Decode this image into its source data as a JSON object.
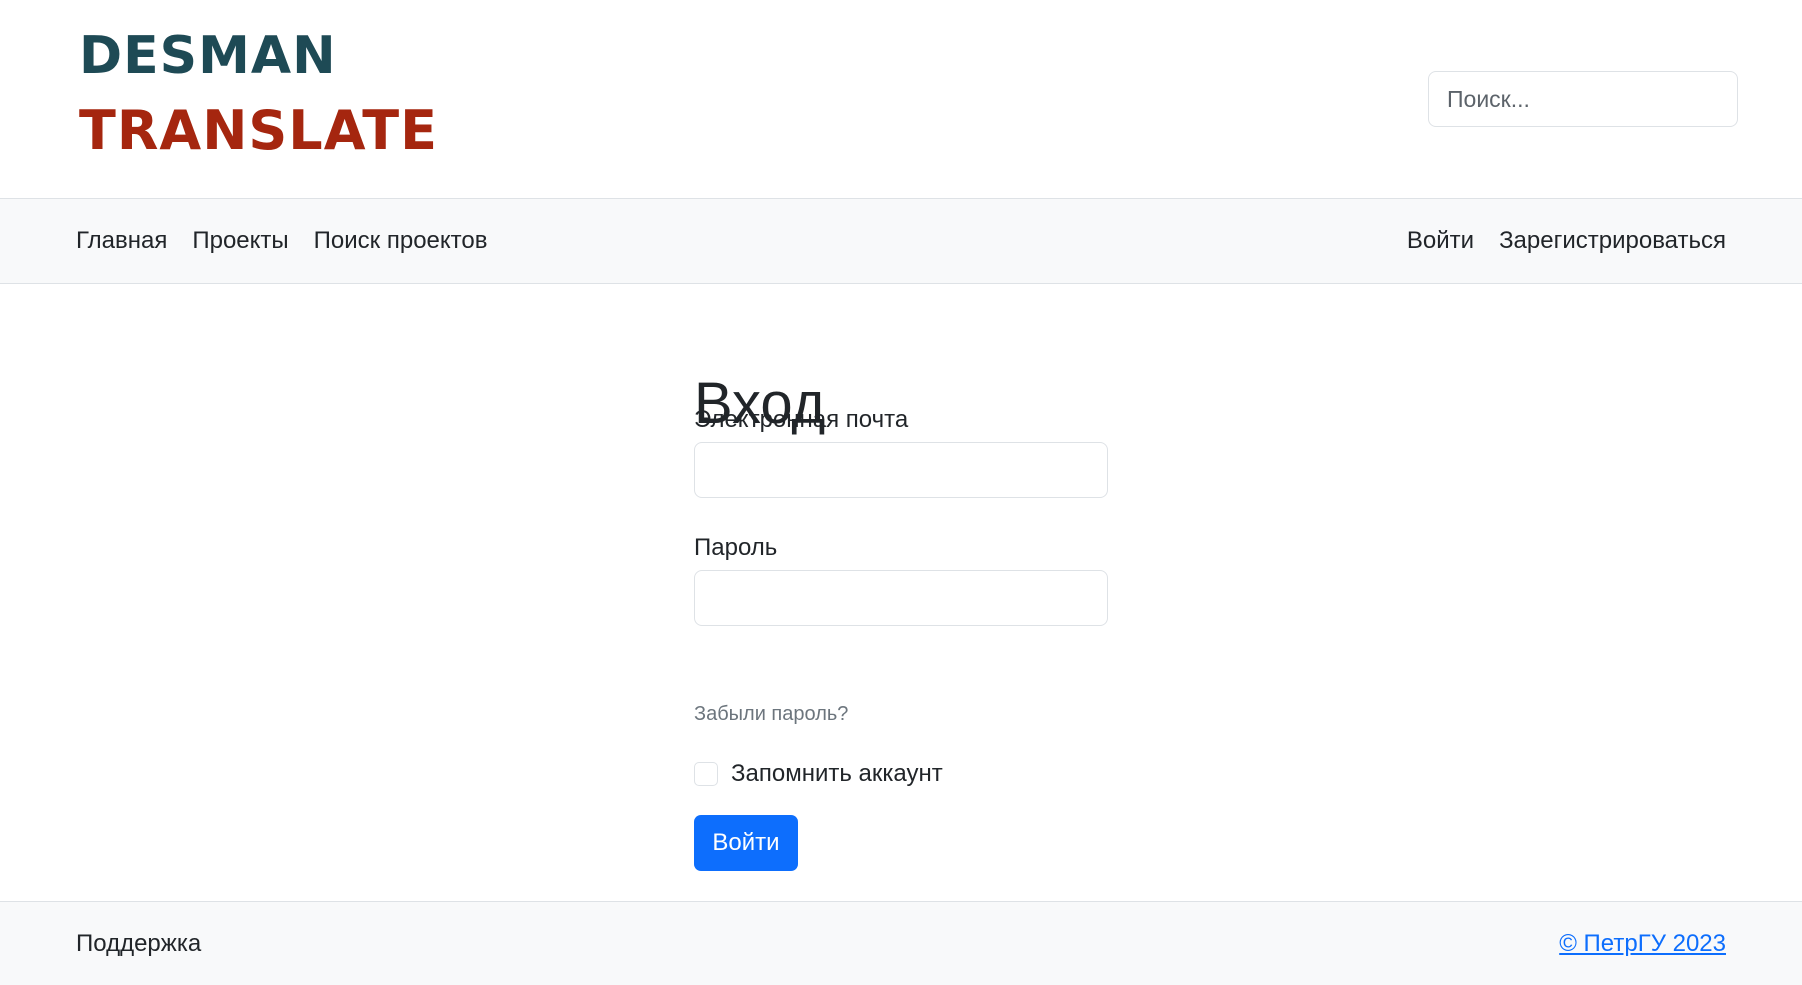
{
  "header": {
    "logo": {
      "line1": "DESMAN",
      "line2": "TRANSLATE",
      "line1_color": "#1e4a55",
      "line2_color": "#a5260f"
    },
    "search": {
      "placeholder": "Поиск...",
      "value": ""
    }
  },
  "nav": {
    "left": [
      {
        "label": "Главная"
      },
      {
        "label": "Проекты"
      },
      {
        "label": "Поиск проектов"
      }
    ],
    "right": [
      {
        "label": "Войти"
      },
      {
        "label": "Зарегистрироваться"
      }
    ]
  },
  "login": {
    "title": "Вход",
    "email": {
      "label": "Электронная почта",
      "value": ""
    },
    "password": {
      "label": "Пароль",
      "value": ""
    },
    "forgot_password": "Забыли пароль?",
    "remember": {
      "label": "Запомнить аккаунт",
      "checked": false
    },
    "submit_label": "Войти"
  },
  "footer": {
    "support": "Поддержка",
    "copyright": "© ПетрГУ 2023"
  },
  "colors": {
    "accent": "#0d6efd",
    "navbar_bg": "#f8f9fa",
    "border": "#dee2e6"
  }
}
